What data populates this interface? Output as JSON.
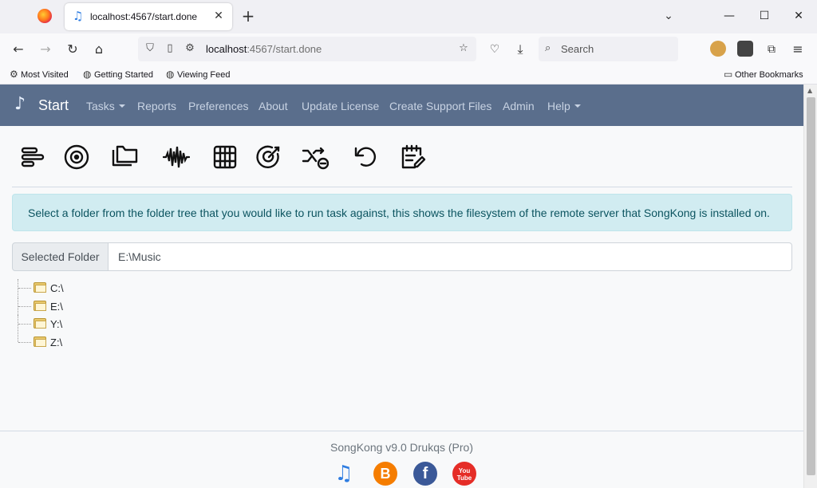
{
  "browser": {
    "tab_title": "localhost:4567/start.done",
    "url_host": "localhost",
    "url_rest": ":4567/start.done",
    "search_placeholder": "Search",
    "bookmarks": [
      "Most Visited",
      "Getting Started",
      "Viewing Feed"
    ],
    "other_bookmarks": "Other Bookmarks"
  },
  "app": {
    "brand": "Start",
    "menu": {
      "tasks": "Tasks",
      "reports": "Reports",
      "preferences": "Preferences",
      "about": "About",
      "update_license": "Update License",
      "create_support_files": "Create Support Files",
      "admin": "Admin",
      "help": "Help"
    },
    "toolbar_icons": [
      "status-icon",
      "target-icon",
      "folders-icon",
      "waveform-icon",
      "grid-icon",
      "bullseye-icon",
      "shuffle-icon",
      "undo-icon",
      "notes-icon"
    ],
    "alert": "Select a folder from the folder tree that you would like to run task against, this shows the filesystem of the remote server that SongKong is installed on.",
    "selected_folder_label": "Selected Folder",
    "selected_folder_value": "E:\\Music",
    "tree": [
      "C:\\",
      "E:\\",
      "Y:\\",
      "Z:\\"
    ],
    "footer": "SongKong v9.0 Drukqs (Pro)",
    "social": {
      "blogger": "B",
      "facebook": "f",
      "youtube": "You Tube"
    }
  },
  "colors": {
    "navbar": "#5a6e8c",
    "alert_bg": "#d1ecf1",
    "alert_text": "#0c5460",
    "blogger": "#f57d00",
    "facebook": "#3b5998",
    "youtube": "#e52d27"
  }
}
